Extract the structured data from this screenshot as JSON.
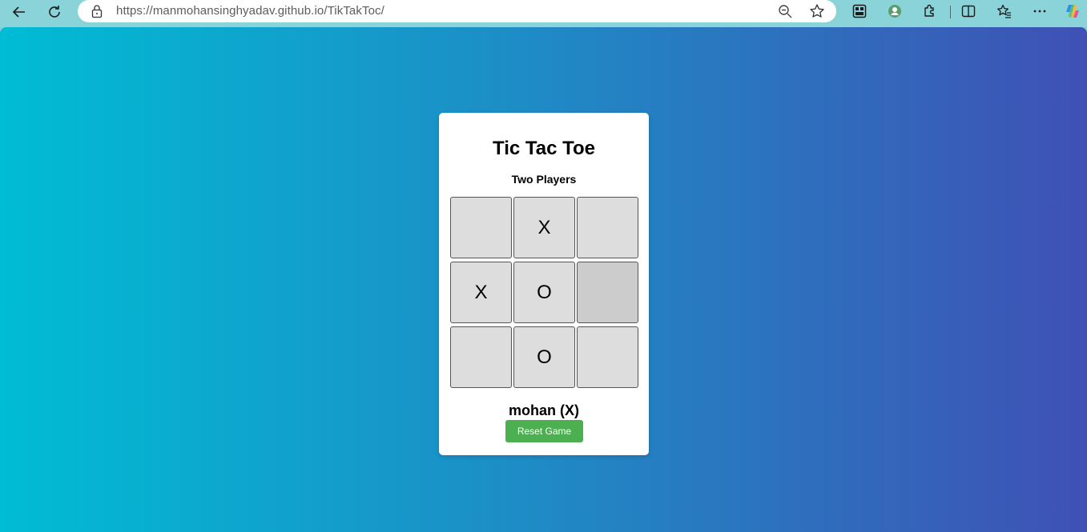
{
  "browser": {
    "url_host": "https://manmohansinghyadav.github.io",
    "url_path": "/TikTakToc/",
    "icons": {
      "back": "back-arrow-icon",
      "refresh": "refresh-icon",
      "lock": "lock-icon",
      "zoom": "zoom-out-icon",
      "favorite": "star-icon",
      "toolbar": [
        "collections-icon",
        "profile-icon",
        "extensions-icon",
        "split-screen-icon",
        "favorites-icon",
        "more-icon",
        "copilot-icon"
      ]
    }
  },
  "game": {
    "title": "Tic Tac Toe",
    "subtitle": "Two Players",
    "board": [
      "",
      "X",
      "",
      "X",
      "O",
      "",
      "",
      "O",
      ""
    ],
    "status": "mohan (X)",
    "reset_label": "Reset Game"
  },
  "colors": {
    "gradient_start": "#00bcd4",
    "gradient_end": "#3f51b5",
    "button": "#4caf50",
    "cell": "#dddddd",
    "cell_hover": "#cccccc"
  }
}
